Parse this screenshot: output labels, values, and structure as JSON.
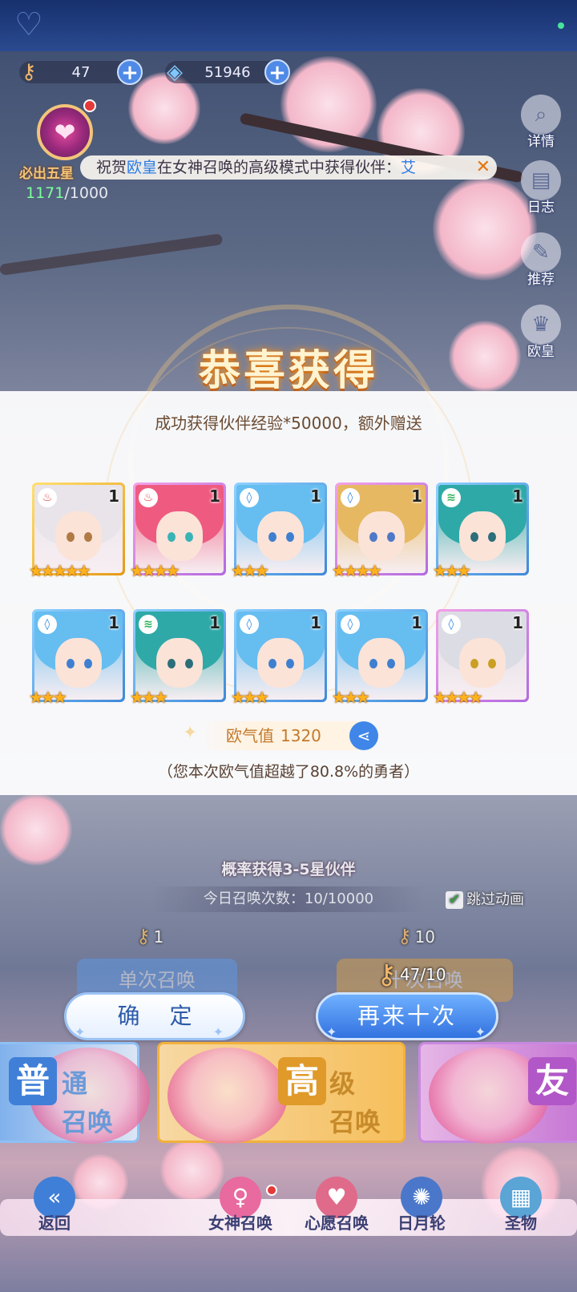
{
  "currency": {
    "keys": {
      "icon": "key-icon",
      "value": "47"
    },
    "gems": {
      "icon": "gem-icon",
      "value": "51946"
    }
  },
  "pity": {
    "label": "必出五星",
    "current": "1171",
    "total": "/1000"
  },
  "marquee": {
    "prefix": "祝贺",
    "name": "欧皇",
    "mid": "在女神召唤的高级模式中获得伙伴：",
    "reward": "艾"
  },
  "side_menu": [
    {
      "label": "详情",
      "icon": "search-icon"
    },
    {
      "label": "日志",
      "icon": "book-icon"
    },
    {
      "label": "推荐",
      "icon": "feather-icon"
    },
    {
      "label": "欧皇",
      "icon": "crown-icon"
    }
  ],
  "result": {
    "title": "恭喜获得",
    "subtitle": "成功获得伙伴经验*50000，额外赠送",
    "cards": [
      {
        "rarity": "ssr",
        "element": "fire",
        "count": "1",
        "stars": 5,
        "hair": "#e8e4ea",
        "eye": "#b07a44"
      },
      {
        "rarity": "sr",
        "element": "fire",
        "count": "1",
        "stars": 4,
        "hair": "#ef5b80",
        "eye": "#39b3b6"
      },
      {
        "rarity": "r",
        "element": "water",
        "count": "1",
        "stars": 3,
        "hair": "#66bdf0",
        "eye": "#3f7fd0"
      },
      {
        "rarity": "sr",
        "element": "water",
        "count": "1",
        "stars": 4,
        "hair": "#e6b861",
        "eye": "#4f79c8"
      },
      {
        "rarity": "r",
        "element": "wind",
        "count": "1",
        "stars": 3,
        "hair": "#2ea9a7",
        "eye": "#2c6e79"
      },
      {
        "rarity": "r",
        "element": "water",
        "count": "1",
        "stars": 3,
        "hair": "#66bdf0",
        "eye": "#3f7fd0"
      },
      {
        "rarity": "r",
        "element": "wind",
        "count": "1",
        "stars": 3,
        "hair": "#2ea9a7",
        "eye": "#2c6e79"
      },
      {
        "rarity": "r",
        "element": "water",
        "count": "1",
        "stars": 3,
        "hair": "#66bdf0",
        "eye": "#3f7fd0"
      },
      {
        "rarity": "r",
        "element": "water",
        "count": "1",
        "stars": 3,
        "hair": "#66bdf0",
        "eye": "#3f7fd0"
      },
      {
        "rarity": "sr",
        "element": "water",
        "count": "1",
        "stars": 4,
        "hair": "#dcdce4",
        "eye": "#c9a024"
      }
    ],
    "luck_label": "欧气值",
    "luck_value": "1320",
    "luck_desc": "（您本次欧气值超越了80.8%的勇者）"
  },
  "summon": {
    "rate_text": "概率获得3-5星伙伴",
    "today": "今日召唤次数：10/10000",
    "skip_label": "跳过动画",
    "skip_checked": true,
    "single_cost": "1",
    "ten_cost": "10",
    "single_label": "单次召唤",
    "ten_label": "十次召唤",
    "key_count": "47/10"
  },
  "buttons": {
    "confirm": "确 定",
    "again": "再来十次"
  },
  "modes": [
    {
      "big": "普",
      "line1": "通",
      "line2": "召唤"
    },
    {
      "big": "高",
      "line1": "级",
      "line2": "召唤"
    },
    {
      "big": "友",
      "line1": "",
      "line2": ""
    }
  ],
  "nav": [
    {
      "label": "返回",
      "icon": "back-arrow-icon"
    },
    {
      "label": "女神召唤",
      "icon": "goddess-icon"
    },
    {
      "label": "心愿召唤",
      "icon": "heart-icon"
    },
    {
      "label": "日月轮",
      "icon": "wheel-icon"
    },
    {
      "label": "圣物",
      "icon": "relic-icon"
    }
  ],
  "colors": {
    "accent_blue": "#3f86e8",
    "gold": "#f3c57a",
    "star": "#ffb21c",
    "fire": "#e53a3a",
    "water": "#2a86e4",
    "wind": "#2eb35a"
  }
}
